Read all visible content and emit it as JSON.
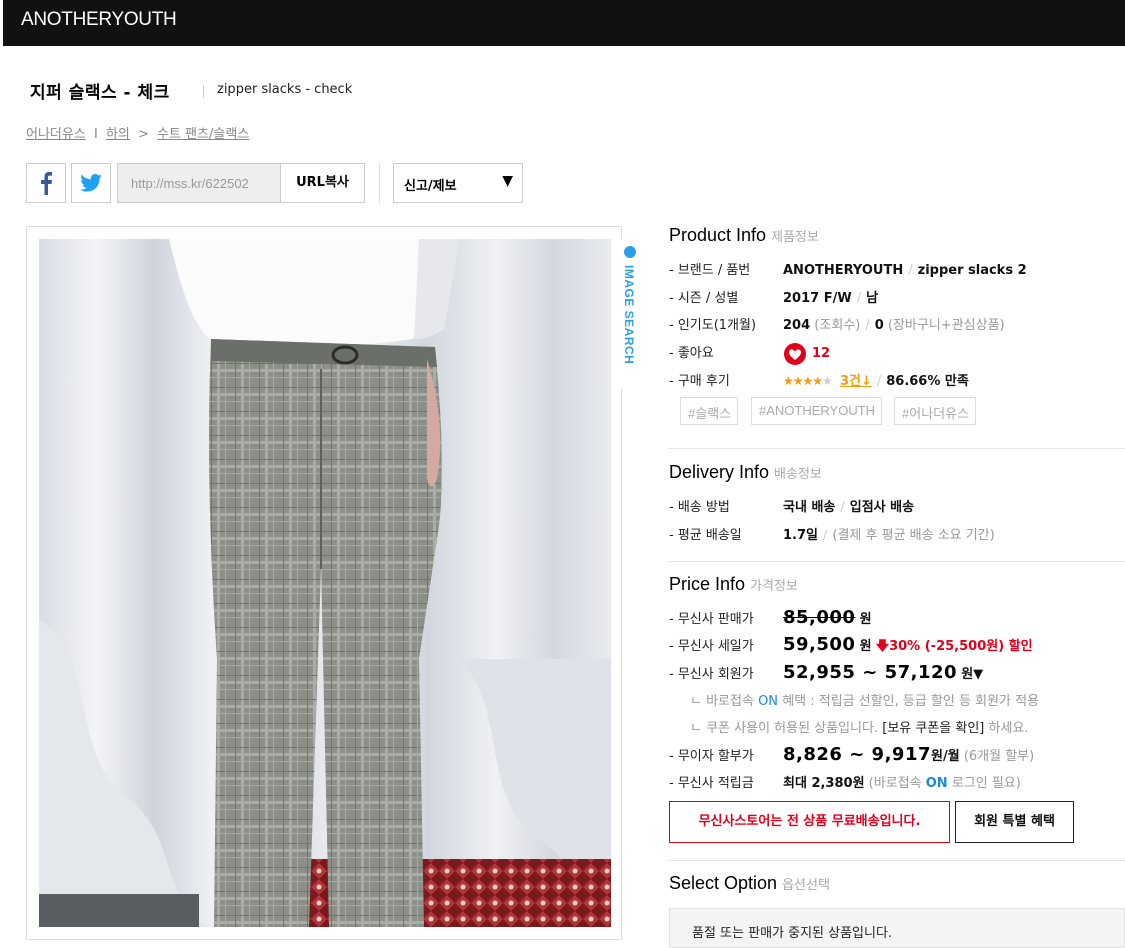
{
  "header": {
    "brand": "ANOTHERYOUTH"
  },
  "product": {
    "title_ko": "지퍼 슬랙스 - 체크",
    "title_en": "zipper slacks - check"
  },
  "breadcrumb": {
    "brand": "어나더유스",
    "sep1": "I",
    "category": "하의",
    "sep2": ">",
    "subcategory": "수트 팬츠/슬랙스"
  },
  "share": {
    "url": "http://mss.kr/622502",
    "copy_label": "URL복사",
    "report_label": "신고/제보",
    "report_arrow": "▼"
  },
  "image_search": {
    "label": "IMAGE SEARCH"
  },
  "product_info": {
    "title": "Product Info",
    "title_ko": "제품정보",
    "brand_label": "- 브랜드 / 품번",
    "brand": "ANOTHERYOUTH",
    "sku": "zipper slacks 2",
    "season_label": "- 시즌 / 성별",
    "season": "2017 F/W",
    "gender": "남",
    "popularity_label": "- 인기도(1개월)",
    "views": "204",
    "views_unit": "(조회수)",
    "carts": "0",
    "carts_unit": "(장바구니+관심상품)",
    "likes_label": "- 좋아요",
    "likes": "12",
    "review_label": "- 구매 후기",
    "stars": "★★★★★",
    "rating": 4,
    "review_count": "3건↓",
    "satisfaction": "86.66% 만족",
    "tags": [
      "#슬랙스",
      "#ANOTHERYOUTH",
      "#어나더유스"
    ]
  },
  "delivery_info": {
    "title": "Delivery Info",
    "title_ko": "배송정보",
    "method_label": "- 배송 방법",
    "method": "국내 배송",
    "method2": "입점사 배송",
    "avg_label": "- 평균 배송일",
    "avg": "1.7일",
    "avg_note": "(결제 후 평균 배송 소요 기간)"
  },
  "price_info": {
    "title": "Price Info",
    "title_ko": "가격정보",
    "list_label": "- 무신사 판매가",
    "list_price": "85,000",
    "won": "원",
    "sale_label": "- 무신사 세일가",
    "sale_price": "59,500",
    "discount": "30% (-25,500원) 할인",
    "member_label": "- 무신사 회원가",
    "member_price": "52,955 ~ 57,120",
    "member_arrow": "▼",
    "note1_pre": "ㄴ 바로접속",
    "note1_on": "ON",
    "note1_post": "혜택 : 적립금 선할인, 등급 할인 등 회원가 적용",
    "note2_pre": "ㄴ 쿠폰 사용이 허용된 상품입니다.",
    "note2_link": "[보유 쿠폰을 확인]",
    "note2_post": "하세요.",
    "install_label": "- 무이자 할부가",
    "install_price": "8,826 ~ 9,917",
    "install_unit": "원/월",
    "install_note": "(6개월 할부)",
    "points_label": "- 무신사 적립금",
    "points": "최대 2,380원",
    "points_note_pre": "(바로접속",
    "points_note_on": "ON",
    "points_note_post": "로그인 필요)",
    "free_ship_button": "무신사스토어는 전 상품 무료배송입니다.",
    "member_benefit_button": "회원 특별 혜택"
  },
  "select_option": {
    "title": "Select Option",
    "title_ko": "옵션선택",
    "soldout_msg": "품절 또는 판매가 중지된 상품입니다."
  },
  "colors": {
    "accent_red": "#e0001b",
    "accent_blue": "#2b9fe6",
    "star": "#f39c12",
    "topbar": "#111111"
  }
}
